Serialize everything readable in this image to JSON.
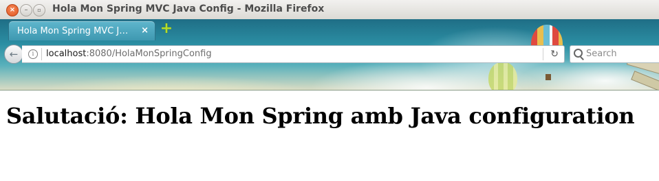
{
  "window": {
    "title": "Hola Mon Spring MVC Java Config - Mozilla Firefox",
    "close_glyph": "×",
    "minimize_glyph": "–",
    "maximize_glyph": "▫"
  },
  "tabs": [
    {
      "label": "Hola Mon Spring MVC J…",
      "close_glyph": "×",
      "active": true
    }
  ],
  "new_tab_glyph": "+",
  "navbar": {
    "back_glyph": "←",
    "info_glyph": "i",
    "url_host": "localhost",
    "url_rest": ":8080/HolaMonSpringConfig",
    "reload_glyph": "↻"
  },
  "search": {
    "placeholder": "Search",
    "icon": "search-icon"
  },
  "page": {
    "heading": "Salutació: Hola Mon Spring amb Java configuration"
  },
  "colors": {
    "accent_tab": "#3e98b1",
    "titlebar": "#dcdad5",
    "close_button": "#e2541c",
    "new_tab_plus": "#b6dd28"
  }
}
